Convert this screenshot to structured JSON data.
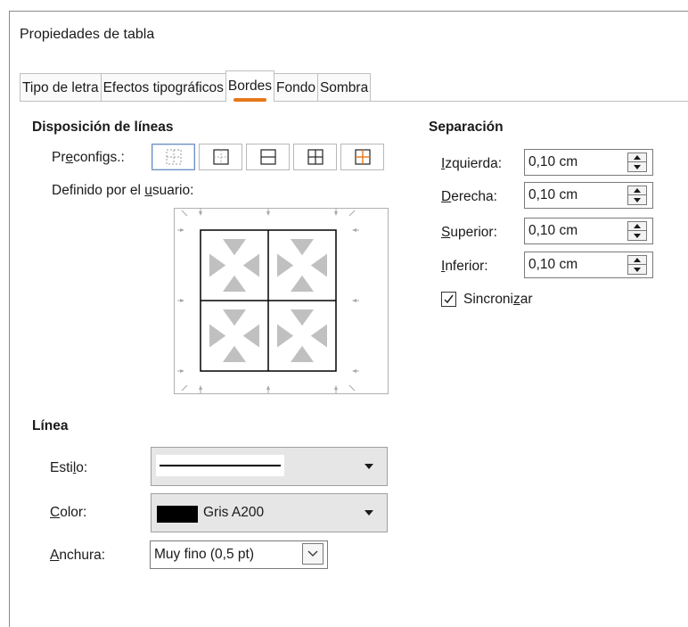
{
  "dialog": {
    "title": "Propiedades de tabla"
  },
  "tabs": [
    {
      "label": "Tipo de letra",
      "active": false
    },
    {
      "label": "Efectos tipográficos",
      "active": false
    },
    {
      "label": "Bordes",
      "active": true
    },
    {
      "label": "Fondo",
      "active": false
    },
    {
      "label": "Sombra",
      "active": false
    }
  ],
  "line_arrangement": {
    "heading": "Disposición de líneas",
    "presets_label_pre": "Pr",
    "presets_label_ul": "e",
    "presets_label_post": "configs.:",
    "presets": [
      {
        "icon": "border-none-icon",
        "selected": true
      },
      {
        "icon": "border-outer-icon",
        "selected": false
      },
      {
        "icon": "border-outer-horizontal-icon",
        "selected": false
      },
      {
        "icon": "border-outer-all-icon",
        "selected": false
      },
      {
        "icon": "border-outer-keep-inner-icon",
        "selected": false
      }
    ],
    "user_defined_label_pre": "Definido por el ",
    "user_defined_label_ul": "u",
    "user_defined_label_post": "suario:"
  },
  "spacing": {
    "heading": "Separación",
    "fields": [
      {
        "label_ul": "I",
        "label_rest": "zquierda:",
        "value": "0,10 cm"
      },
      {
        "label_ul": "D",
        "label_rest": "erecha:",
        "value": "0,10 cm"
      },
      {
        "label_ul": "S",
        "label_rest": "uperior:",
        "value": "0,10 cm"
      },
      {
        "label_ul": "I",
        "label_rest": "nferior:",
        "value": "0,10 cm"
      }
    ],
    "sync_label_pre": "Sincroni",
    "sync_label_ul": "z",
    "sync_label_post": "ar",
    "sync_checked": true
  },
  "line": {
    "heading": "Línea",
    "style_label_pre": "Esti",
    "style_label_ul": "l",
    "style_label_post": "o:",
    "color_label_ul": "C",
    "color_label_rest": "olor:",
    "color_name": "Gris A200",
    "color_swatch": "#000000",
    "width_label_ul": "A",
    "width_label_rest": "nchura:",
    "width_value": "Muy fino (0,5 pt)"
  },
  "colors": {
    "accent": "#e6781a",
    "preset_highlight": "#e6781a",
    "preview_triangles": "#c0c0c0"
  }
}
